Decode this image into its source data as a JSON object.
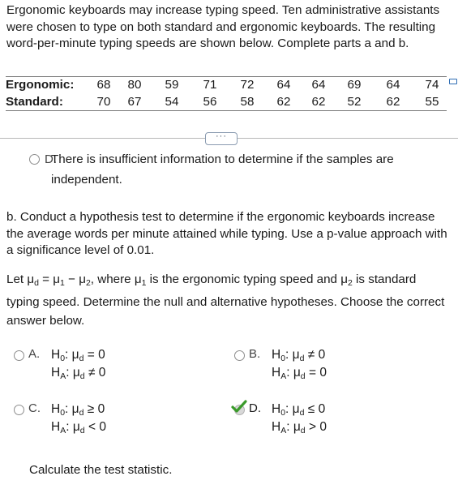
{
  "intro_text": "Ergonomic keyboards may increase typing speed. Ten administrative assistants were chosen to type on both standard and ergonomic keyboards. The resulting word-per-minute typing speeds are shown below. Complete parts a and b.",
  "table": {
    "rows": [
      {
        "label": "Ergonomic:",
        "values": [
          "68",
          "80",
          "59",
          "71",
          "72",
          "64",
          "64",
          "69",
          "64",
          "74"
        ]
      },
      {
        "label": "Standard:",
        "values": [
          "70",
          "67",
          "54",
          "56",
          "58",
          "62",
          "62",
          "52",
          "62",
          "55"
        ]
      }
    ],
    "expand_icon": "expand-table-icon"
  },
  "more_button_label": "···",
  "prev_option_d": {
    "letter": "D.",
    "text_line1": "There is insufficient information to determine if the samples are",
    "text_line2": "independent."
  },
  "part_b_text": "b. Conduct a hypothesis test to determine if the ergonomic keyboards increase the average words per minute attained while typing. Use a p-value approach with a significance level of 0.01.",
  "let_text": {
    "prefix": "Let ",
    "definition": "μ",
    "middle": ", where ",
    "tail": " is the ergonomic typing speed and ",
    "tail2": " is standard",
    "line2": "typing speed. Determine the null and alternative hypotheses. Choose the correct answer below."
  },
  "options": [
    {
      "letter": "A.",
      "h0": "H₀: μd = 0",
      "ha": "HA: μd ≠ 0",
      "h0_op": "=",
      "ha_op": "≠",
      "selected": false
    },
    {
      "letter": "B.",
      "h0": "H₀: μd ≠ 0",
      "ha": "HA: μd = 0",
      "h0_op": "≠",
      "ha_op": "=",
      "selected": false
    },
    {
      "letter": "C.",
      "h0": "H₀: μd ≥ 0",
      "ha": "HA: μd < 0",
      "h0_op": "≥",
      "ha_op": "<",
      "selected": false
    },
    {
      "letter": "D.",
      "h0": "H₀: μd ≤ 0",
      "ha": "HA: μd > 0",
      "h0_op": "≤",
      "ha_op": ">",
      "selected": true
    }
  ],
  "h0_label": "H",
  "h0_sub": "0",
  "ha_label": "H",
  "ha_sub": "A",
  "mu_symbol": "μ",
  "d_sub": "d",
  "zero": "0",
  "calc_text": "Calculate the test statistic.",
  "colors": {
    "correct_check": "#3a9a2a",
    "radio_border": "#8c8c8c",
    "expand_icon": "#2e6db4"
  }
}
